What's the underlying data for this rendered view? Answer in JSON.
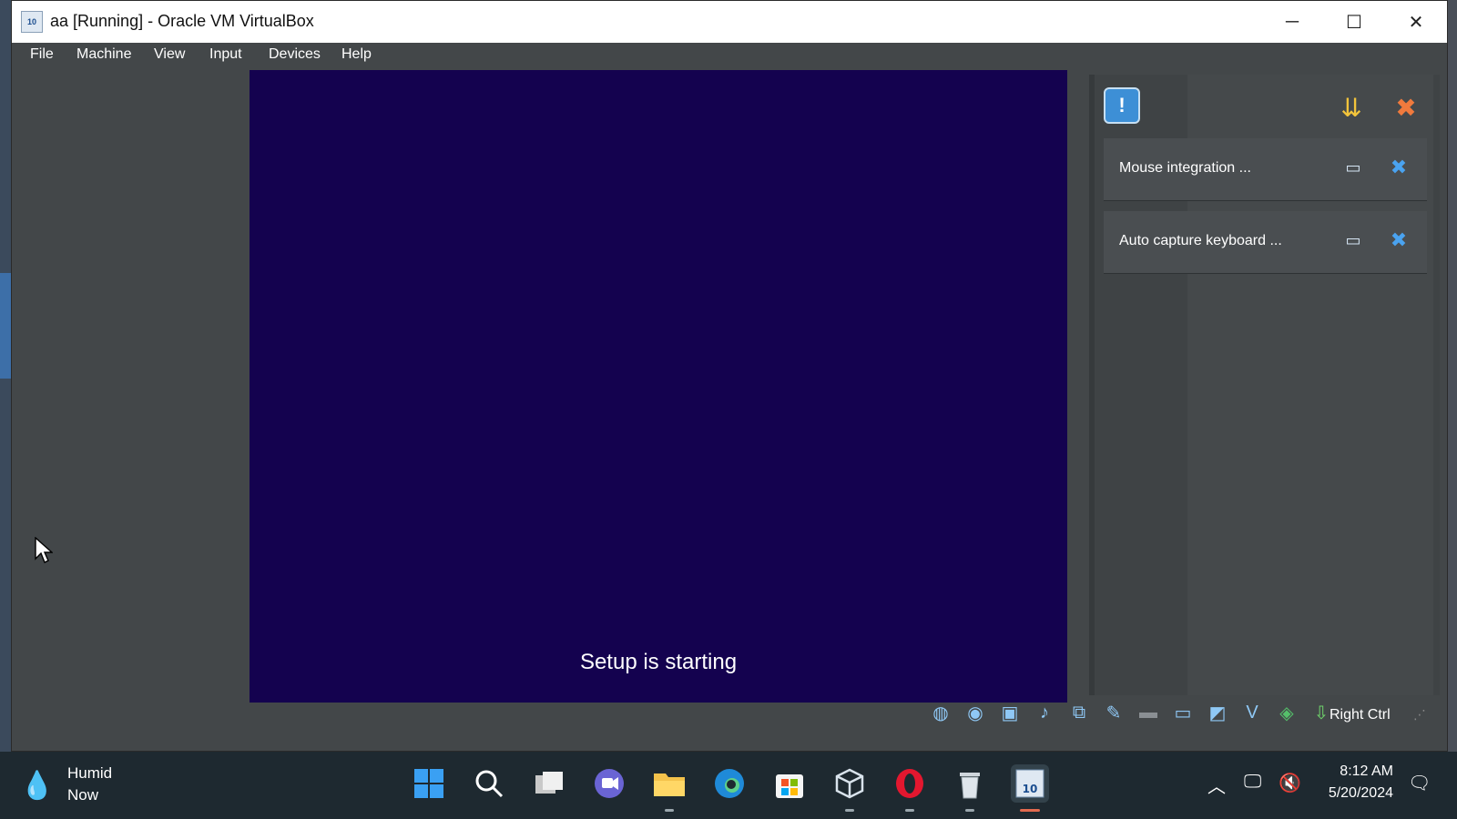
{
  "window": {
    "title": "aa [Running] - Oracle VM VirtualBox",
    "app_icon_text": "10",
    "controls": {
      "minimize": "─",
      "maximize": "☐",
      "close": "✕"
    }
  },
  "menu": [
    "File",
    "Machine",
    "View",
    "Input",
    "Devices",
    "Help"
  ],
  "vm": {
    "status_text": "Setup is starting",
    "screen_color": "#14024f"
  },
  "notifications": {
    "header_icons": [
      "warning-icon",
      "sort-icon",
      "close-all-icon"
    ],
    "items": [
      {
        "text": "Mouse integration ..."
      },
      {
        "text": "Auto capture keyboard ..."
      }
    ]
  },
  "statusbar": {
    "icons": [
      "hard-disk-icon",
      "optical-drive-icon",
      "floppy-icon",
      "audio-icon",
      "network-icon",
      "usb-icon",
      "shared-folder-icon",
      "display-icon",
      "recording-icon",
      "virtualization-icon",
      "cpu-icon",
      "update-icon",
      "mouse-integration-icon"
    ],
    "host_key": "Right Ctrl"
  },
  "taskbar": {
    "weather": {
      "condition": "Humid",
      "time": "Now"
    },
    "apps": [
      "start-icon",
      "search-icon",
      "task-view-icon",
      "chat-icon",
      "file-explorer-icon",
      "edge-icon",
      "store-icon",
      "virtualbox-icon",
      "opera-icon",
      "recycle-bin-icon",
      "vm-window-icon"
    ],
    "clock": {
      "time": "8:12 AM",
      "date": "5/20/2024"
    }
  }
}
